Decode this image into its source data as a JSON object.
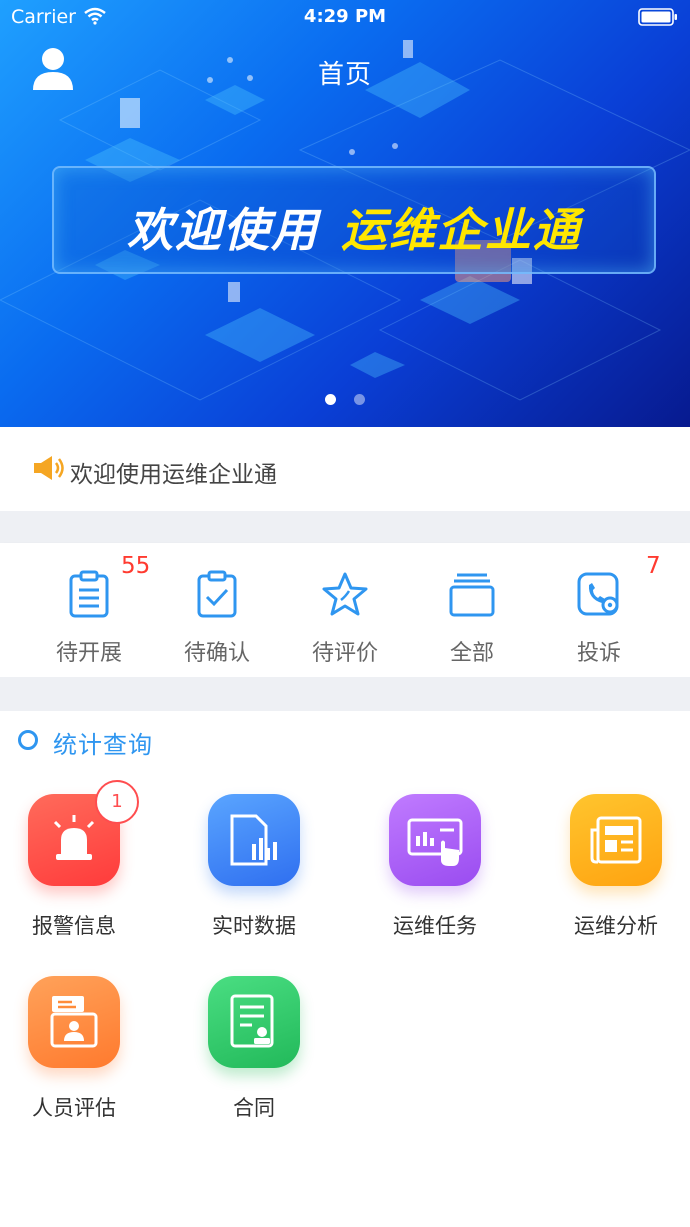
{
  "status_bar": {
    "carrier": "Carrier",
    "time": "4:29 PM"
  },
  "header": {
    "title": "首页"
  },
  "banner": {
    "welcome_prefix": "欢迎使用",
    "welcome_highlight": "运维企业通",
    "slides": 2,
    "active_slide": 1
  },
  "notice": {
    "text": "欢迎使用运维企业通"
  },
  "status_row": [
    {
      "label": "待开展",
      "badge": "55",
      "icon": "clipboard-list-icon"
    },
    {
      "label": "待确认",
      "badge": "",
      "icon": "clipboard-check-icon"
    },
    {
      "label": "待评价",
      "badge": "",
      "icon": "star-icon"
    },
    {
      "label": "全部",
      "badge": "",
      "icon": "stack-icon"
    },
    {
      "label": "投诉",
      "badge": "7",
      "icon": "phone-gear-icon"
    }
  ],
  "stats": {
    "title": "统计查询",
    "tiles": [
      {
        "label": "报警信息",
        "badge": "1",
        "icon": "alarm-icon",
        "color_from": "#ff6b5b",
        "color_to": "#ff3b3b"
      },
      {
        "label": "实时数据",
        "badge": "",
        "icon": "data-doc-icon",
        "color_from": "#5aa5ff",
        "color_to": "#2f6ff0"
      },
      {
        "label": "运维任务",
        "badge": "",
        "icon": "task-screen-icon",
        "color_from": "#c07bff",
        "color_to": "#9a4cf0"
      },
      {
        "label": "运维分析",
        "badge": "",
        "icon": "newspaper-icon",
        "color_from": "#ffc52e",
        "color_to": "#ffa310"
      },
      {
        "label": "人员评估",
        "badge": "",
        "icon": "id-card-icon",
        "color_from": "#ffa25a",
        "color_to": "#ff7a2e"
      },
      {
        "label": "合同",
        "badge": "",
        "icon": "contract-icon",
        "color_from": "#4ade82",
        "color_to": "#22b95a"
      }
    ]
  },
  "colors": {
    "accent": "#2f96f0",
    "badge_red": "#ff3b30",
    "banner_dark": "#071a8f"
  }
}
